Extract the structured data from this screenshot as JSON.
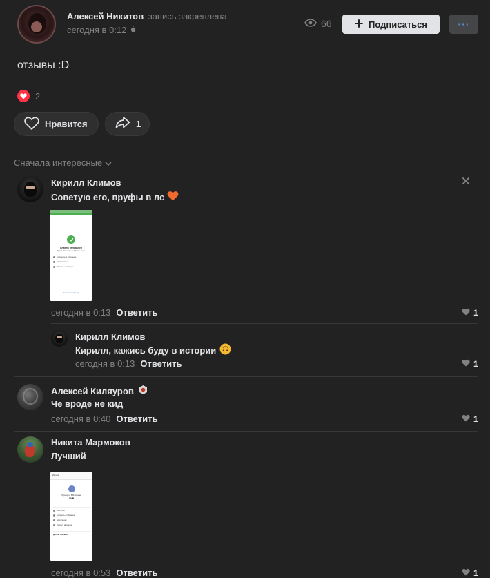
{
  "colors": {
    "background": "#222222",
    "accent_like": "#ff3347",
    "button": "#454647",
    "text": "#e1e3e6",
    "muted": "#828282"
  },
  "post": {
    "author_name": "Алексей Никитов",
    "pinned_note": "запись закреплена",
    "time": "сегодня в 0:12",
    "views": "66",
    "subscribe_label": "Подписаться",
    "more_label": "···",
    "text": "отзывы :D",
    "reactions_count": "2",
    "like_label": "Нравится",
    "share_count": "1"
  },
  "comments_header": {
    "sort_label": "Сначала интересные"
  },
  "comments": [
    {
      "author": "Кирилл Климов",
      "text": "Советую его, пруфы в лс",
      "emoji": "heart-emoji",
      "time": "сегодня в 0:13",
      "reply_label": "Ответить",
      "likes": "1",
      "attachment": {
        "title": "Платеж отправлен",
        "subtitle": "500 ₽ · Перевод на ЮМ-Кошелек",
        "rows": [
          "Сохранить в избранное",
          "Автоплатежи",
          "Показать квитанцию"
        ],
        "footer": "На главную страницу"
      }
    },
    {
      "author": "Кирилл Климов",
      "text": "Кирилл, кажись буду в истории",
      "emoji": "upside-down-face-emoji",
      "time": "сегодня в 0:13",
      "reply_label": "Ответить",
      "likes": "1"
    },
    {
      "author": "Алексей Киляуров",
      "text": "Че вроде не кид",
      "time": "сегодня в 0:40",
      "reply_label": "Ответить",
      "likes": "1"
    },
    {
      "author": "Никита Мармоков",
      "text": "Лучший",
      "time": "сегодня в 0:53",
      "reply_label": "Ответить",
      "likes": "1",
      "attachment": {
        "header": "Истории",
        "title": "Перевод на ЮМ-Кошелек",
        "amount": "50 ₽",
        "rows": [
          "Повторить",
          "Сохранить в избранное",
          "Автоплатежи",
          "Показать квитанцию"
        ],
        "section": "Детали платежа"
      }
    }
  ]
}
